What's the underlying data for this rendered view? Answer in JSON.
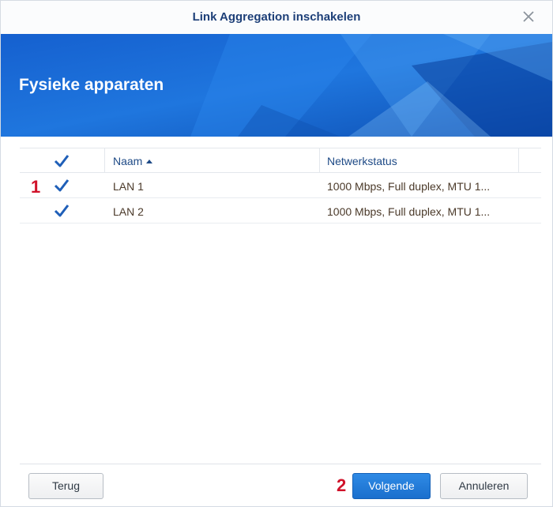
{
  "dialog": {
    "title": "Link Aggregation inschakelen",
    "banner_title": "Fysieke apparaten"
  },
  "table": {
    "columns": [
      "Naam",
      "Netwerkstatus"
    ],
    "sort_column": "Naam",
    "sort_direction": "ascending",
    "header_checkbox_checked": true,
    "rows": [
      {
        "name": "LAN 1",
        "status": "1000 Mbps, Full duplex, MTU 1...",
        "checked": true
      },
      {
        "name": "LAN 2",
        "status": "1000 Mbps, Full duplex, MTU 1...",
        "checked": true
      }
    ]
  },
  "annotations": {
    "step1": "1",
    "step2": "2"
  },
  "buttons": {
    "back": "Terug",
    "next": "Volgende",
    "cancel": "Annuleren"
  },
  "icons": {
    "close": "close-icon",
    "checkbox": "checkmark-icon",
    "sort": "sort-ascending-icon"
  },
  "colors": {
    "title": "#1d3f78",
    "banner_blue": "#1f6fd3",
    "primary_button": "#1a6fcd",
    "annotation_red": "#d0122a",
    "check_blue": "#1f5fb8"
  }
}
